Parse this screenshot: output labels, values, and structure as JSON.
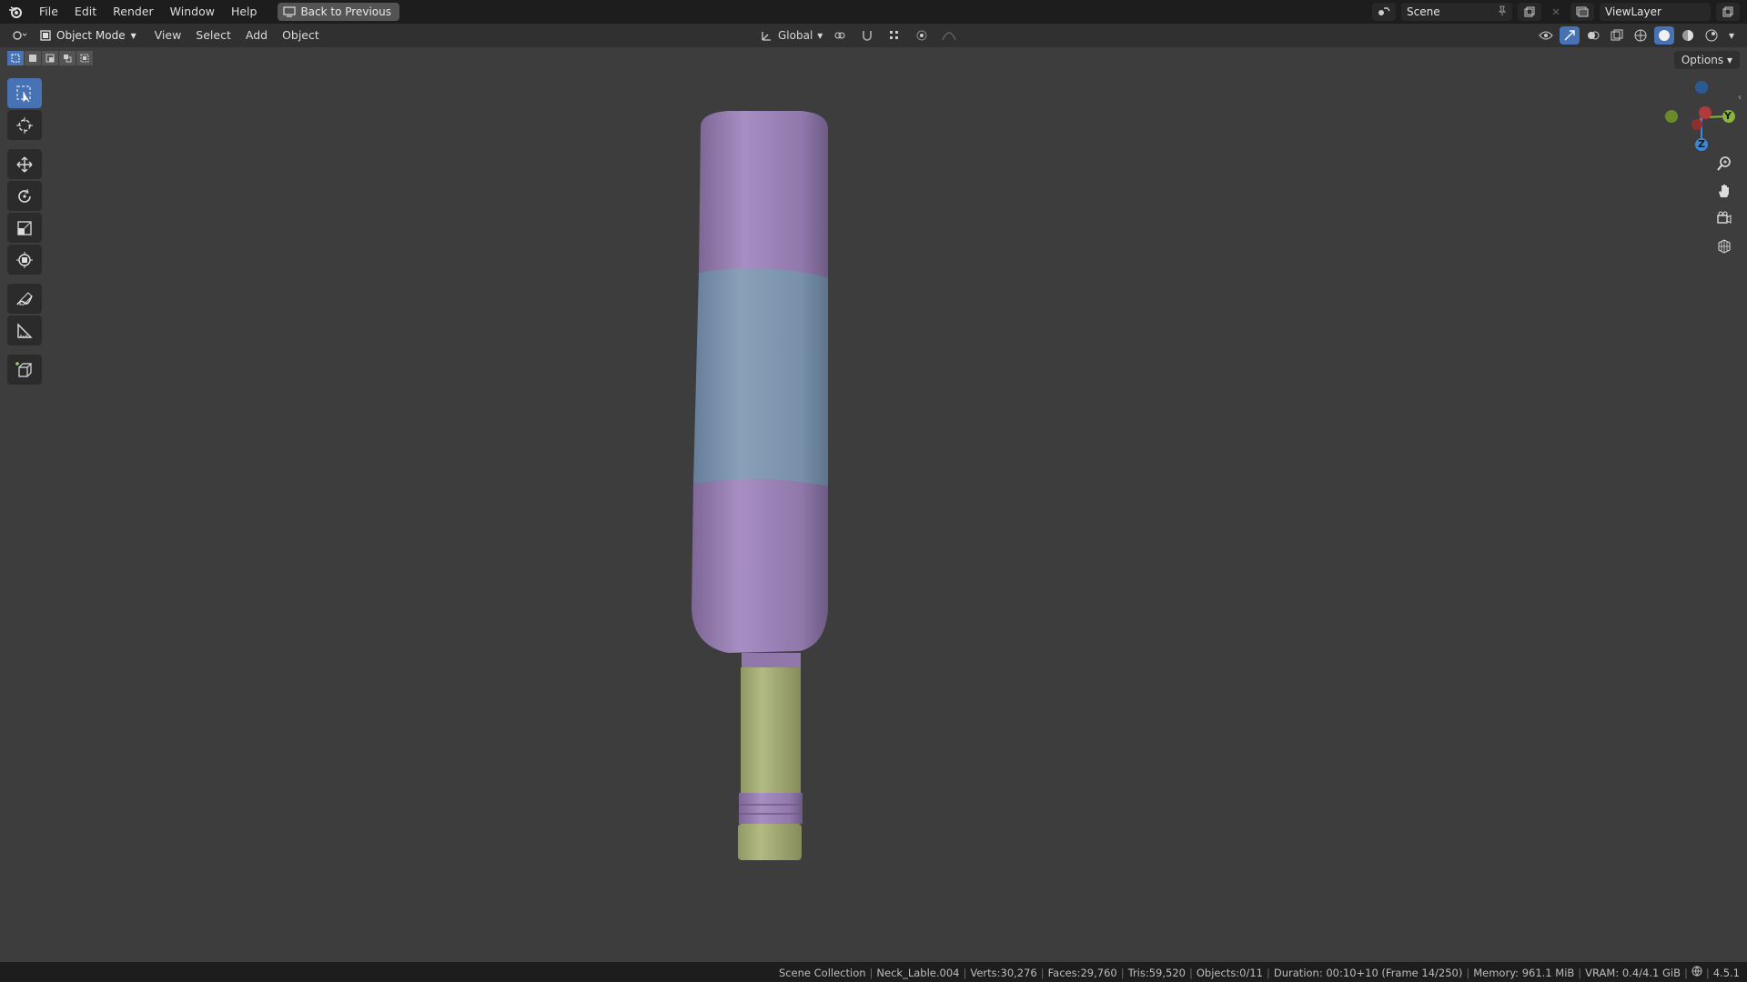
{
  "menu": {
    "logo_icon": "blender-logo-icon",
    "items": [
      "File",
      "Edit",
      "Render",
      "Window",
      "Help"
    ],
    "back_label": "Back to Previous"
  },
  "topright": {
    "scene_label": "Scene",
    "viewlayer_label": "ViewLayer"
  },
  "header": {
    "mode_label": "Object Mode",
    "menus": [
      "View",
      "Select",
      "Add",
      "Object"
    ],
    "transform_orientation": "Global",
    "options_label": "Options"
  },
  "toolbar": {
    "tools": [
      "select-box-icon",
      "cursor-icon",
      "move-icon",
      "rotate-icon",
      "scale-icon",
      "transform-icon",
      "annotate-icon",
      "measure-icon",
      "add-cube-icon"
    ]
  },
  "gizmo": {
    "x_label": "X",
    "y_label": "Y",
    "z_label": "Z"
  },
  "statusbar": {
    "collection": "Scene Collection",
    "object": "Neck_Lable.004",
    "verts": "Verts:30,276",
    "faces": "Faces:29,760",
    "tris": "Tris:59,520",
    "objects": "Objects:0/11",
    "duration": "Duration: 00:10+10 (Frame 14/250)",
    "memory": "Memory: 961.1 MiB",
    "vram": "VRAM: 0.4/4.1 GiB",
    "version": "4.5.1"
  },
  "colors": {
    "purple": "#9a7fb8",
    "blue": "#7b93ad",
    "yellow_green": "#a9b178",
    "accent": "#4772b3"
  }
}
